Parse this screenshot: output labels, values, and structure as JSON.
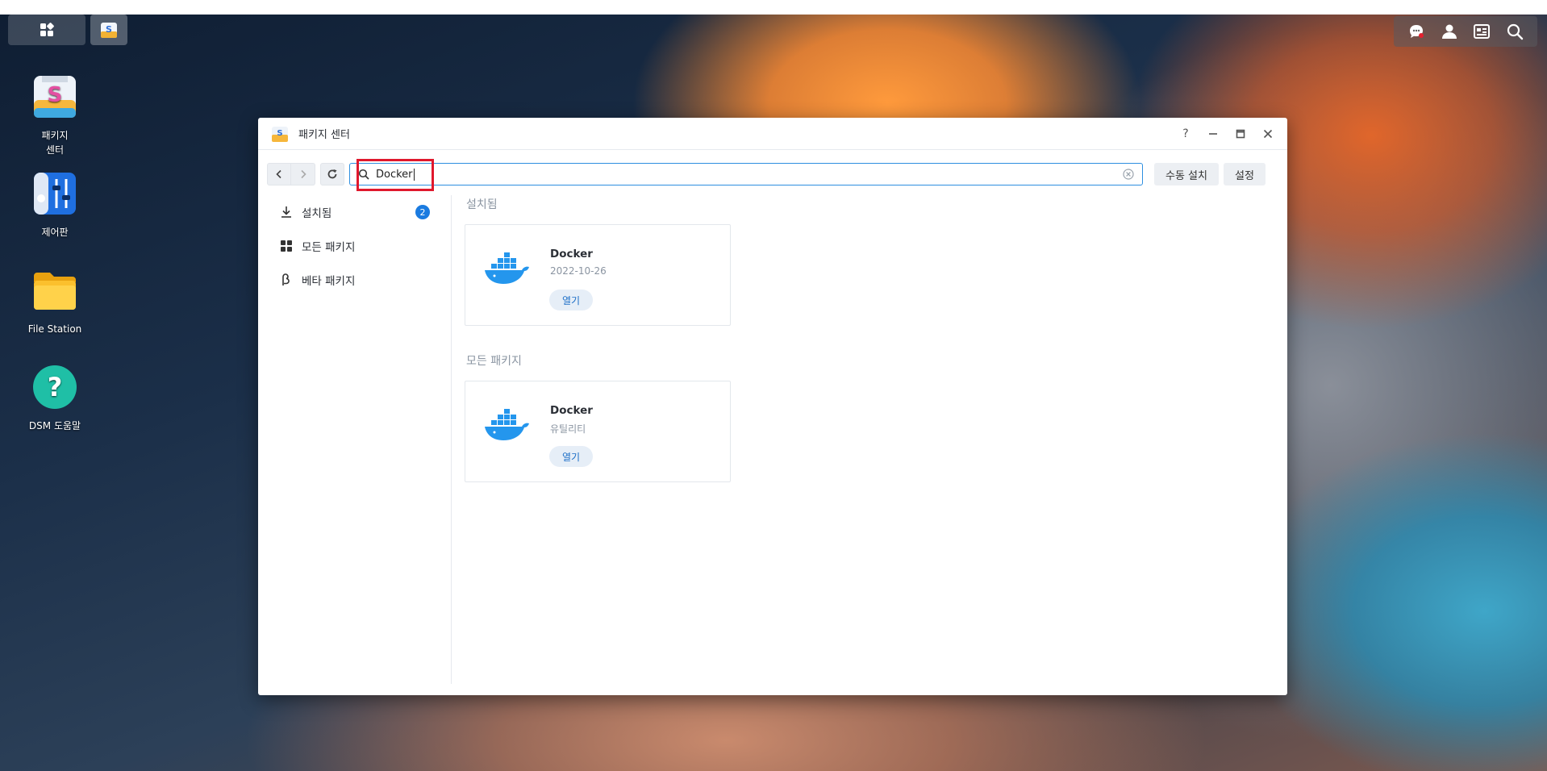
{
  "desktop": {
    "icons": [
      {
        "label": "패키지\n센터"
      },
      {
        "label": "제어판"
      },
      {
        "label": "File Station"
      },
      {
        "label": "DSM 도움말"
      }
    ]
  },
  "window": {
    "title": "패키지 센터",
    "controls": {
      "help": "?"
    },
    "toolbar": {
      "search_value": "Docker",
      "manual_install_label": "수동 설치",
      "settings_label": "설정"
    },
    "sidebar": {
      "items": [
        {
          "label": "설치됨",
          "badge": "2"
        },
        {
          "label": "모든 패키지"
        },
        {
          "label": "베타 패키지"
        }
      ]
    },
    "sections": [
      {
        "title": "설치됨",
        "card": {
          "name": "Docker",
          "sub": "2022-10-26",
          "button": "열기"
        }
      },
      {
        "title": "모든 패키지",
        "card": {
          "name": "Docker",
          "sub": "유틸리티",
          "button": "열기"
        }
      }
    ]
  },
  "colors": {
    "accent": "#1a7be0",
    "highlight": "#e0182d",
    "docker_blue": "#2496ed"
  }
}
